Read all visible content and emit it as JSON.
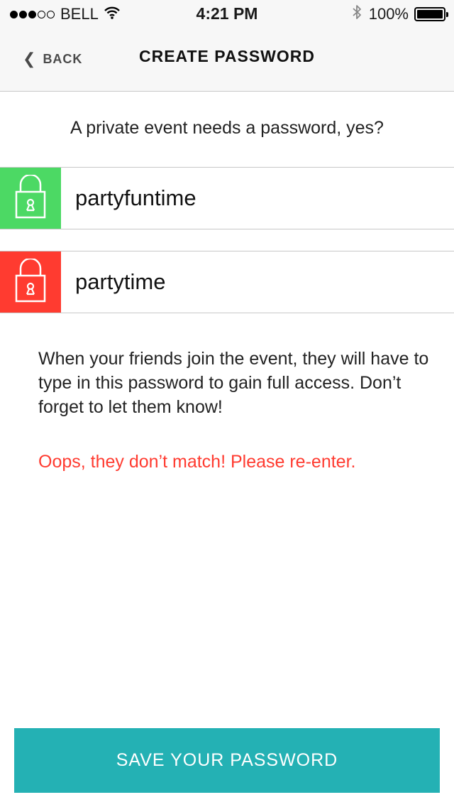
{
  "status_bar": {
    "carrier": "BELL",
    "time": "4:21 PM",
    "battery": "100%",
    "signal_bars_filled": 3,
    "signal_bars_total": 5
  },
  "nav": {
    "back_label": "BACK",
    "title": "CREATE PASSWORD"
  },
  "prompt": "A private event needs a password, yes?",
  "fields": {
    "password": {
      "value": "partyfuntime",
      "status": "valid",
      "color": "#4cd964"
    },
    "confirm": {
      "value": "partytime",
      "status": "invalid",
      "color": "#ff3b30"
    }
  },
  "info_text": "When your friends join the event, they will have to type in this password to gain full access. Don’t forget to let them know!",
  "error_text": "Oops, they don’t match! Please re-enter.",
  "save_label": "SAVE YOUR PASSWORD",
  "colors": {
    "accent": "#24b1b4",
    "error": "#ff3b30",
    "success": "#4cd964"
  },
  "icons": [
    "wifi-icon",
    "bluetooth-icon",
    "battery-icon",
    "chevron-left-icon",
    "lock-icon"
  ]
}
